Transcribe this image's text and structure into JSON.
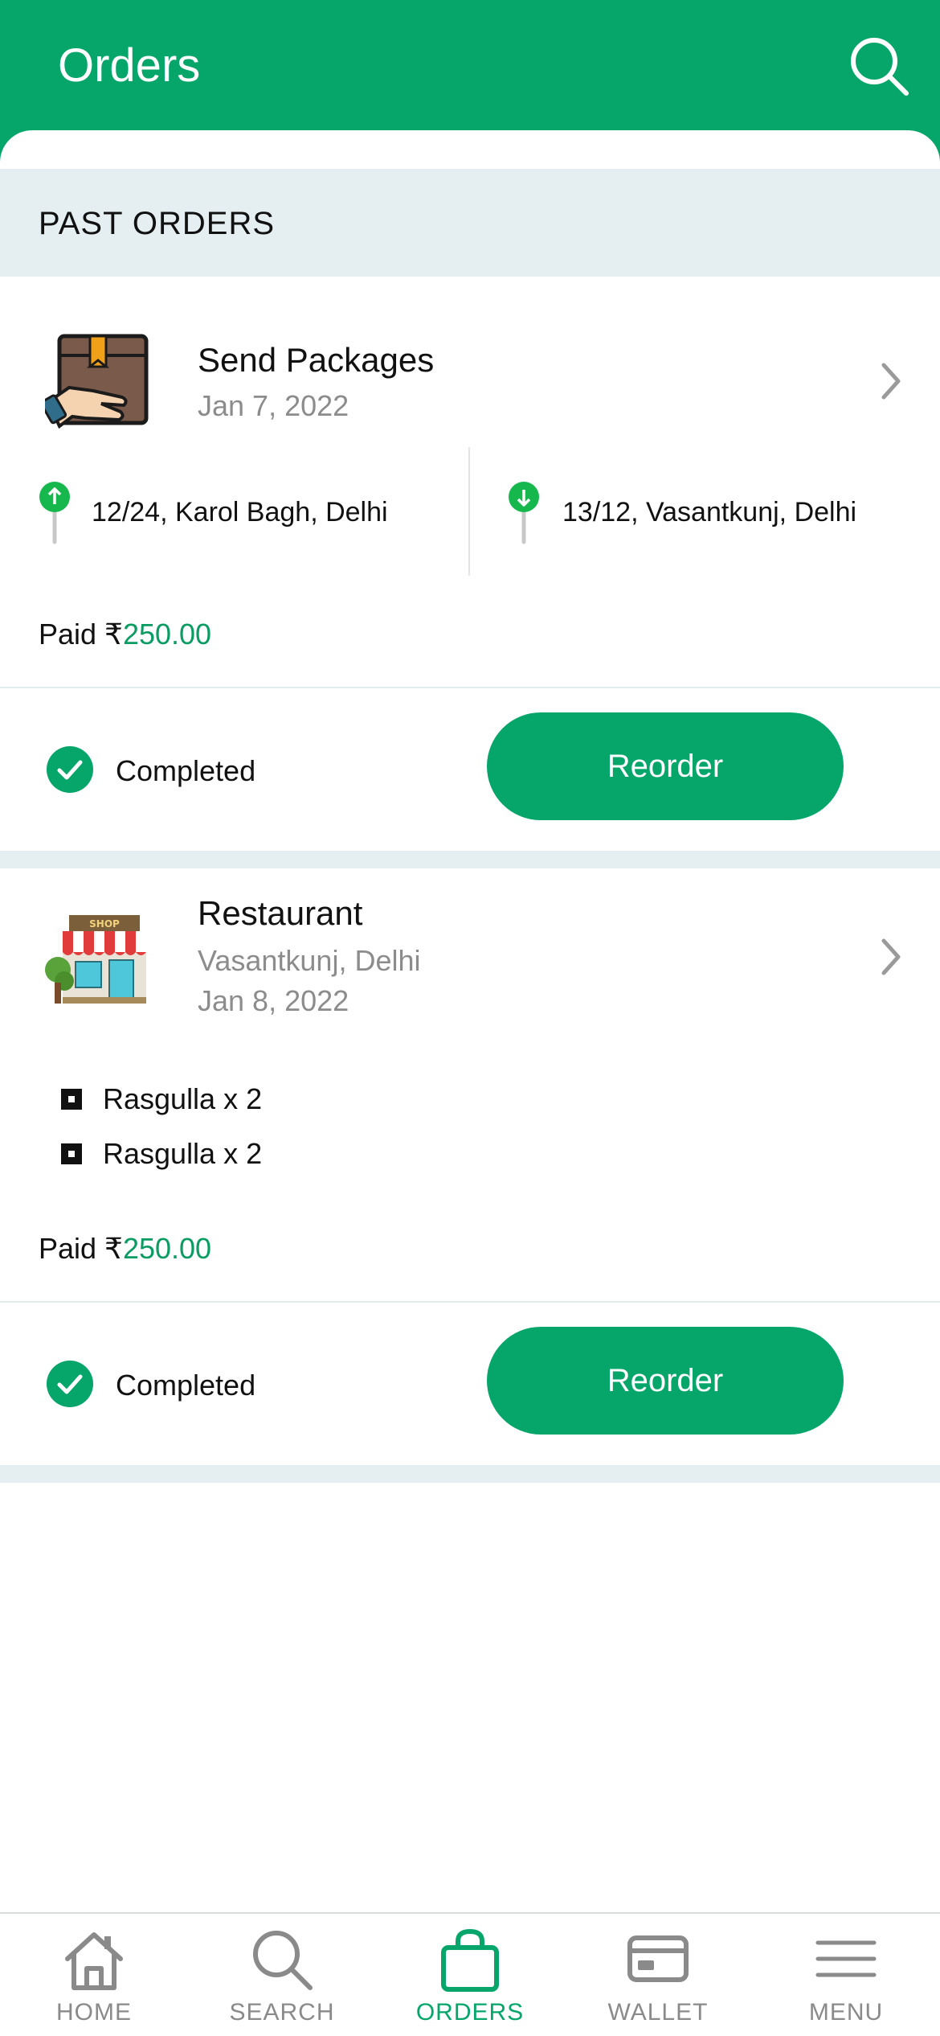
{
  "header": {
    "title": "Orders",
    "search_icon": "search-icon"
  },
  "section": {
    "title": "PAST ORDERS"
  },
  "orders": [
    {
      "title": "Send Packages",
      "date": "Jan 7, 2022",
      "icon": "package-hand-icon",
      "pickup": "12/24, Karol Bagh, Delhi",
      "dropoff": "13/12, Vasantkunj, Delhi",
      "paid_label": "Paid ₹",
      "amount": "250.00",
      "status": "Completed",
      "reorder_label": "Reorder"
    },
    {
      "title": "Restaurant",
      "location": "Vasantkunj, Delhi",
      "date": "Jan 8, 2022",
      "icon": "shop-icon",
      "items": [
        "Rasgulla x 2",
        "Rasgulla x 2"
      ],
      "paid_label": "Paid ₹",
      "amount": "250.00",
      "status": "Completed",
      "reorder_label": "Reorder"
    }
  ],
  "nav": [
    {
      "label": "HOME",
      "icon": "home-icon",
      "active": false
    },
    {
      "label": "SEARCH",
      "icon": "search-icon",
      "active": false
    },
    {
      "label": "ORDERS",
      "icon": "bag-icon",
      "active": true
    },
    {
      "label": "WALLET",
      "icon": "wallet-icon",
      "active": false
    },
    {
      "label": "MENU",
      "icon": "menu-icon",
      "active": false
    }
  ],
  "colors": {
    "brand": "#06a66b",
    "section_bg": "#e5eef0",
    "muted": "#8c8c8c",
    "amount": "#0a9c62"
  }
}
